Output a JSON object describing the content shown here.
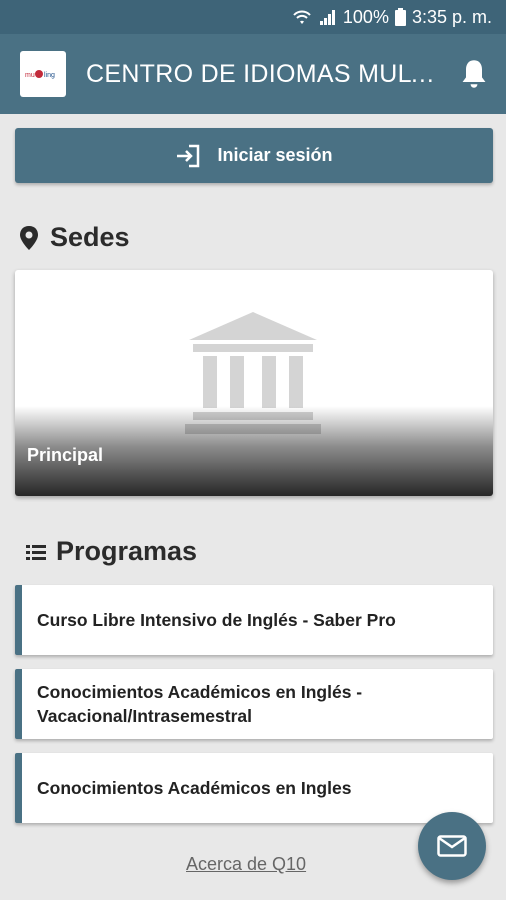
{
  "status_bar": {
    "battery": "100%",
    "time": "3:35 p. m.",
    "icons": [
      "wifi-icon",
      "signal-icon",
      "battery-icon"
    ]
  },
  "app_bar": {
    "title": "CENTRO DE IDIOMAS MULTILINGÜE",
    "logo_icon": "school-logo",
    "notification_icon": "bell-icon"
  },
  "login_button": {
    "label": "Iniciar sesión",
    "icon": "login-icon"
  },
  "sedes": {
    "title": "Sedes",
    "icon": "location-pin-icon",
    "items": [
      {
        "name": "Principal",
        "icon": "building-icon"
      }
    ]
  },
  "programas": {
    "title": "Programas",
    "icon": "list-icon",
    "items": [
      {
        "label": "Curso Libre Intensivo de Inglés - Saber Pro"
      },
      {
        "label": "Conocimientos Académicos en Inglés - Vacacional/Intrasemestral"
      },
      {
        "label": "Conocimientos Académicos en Ingles"
      }
    ]
  },
  "footer": {
    "about_link": "Acerca de Q10"
  },
  "fab": {
    "icon": "mail-icon"
  },
  "colors": {
    "primary": "#4a7184",
    "status_bar": "#3e6478",
    "background": "#e8e8e8"
  }
}
